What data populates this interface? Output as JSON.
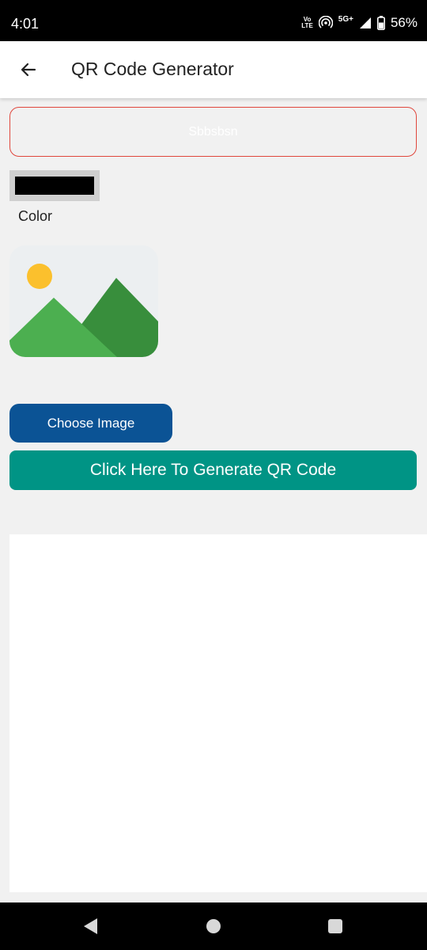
{
  "status_bar": {
    "time": "4:01",
    "volte_top": "Vo",
    "volte_bottom": "LTE",
    "network": "5G+",
    "battery": "56%",
    "icons": [
      "volte-icon",
      "hotspot-icon",
      "signal-icon",
      "battery-icon"
    ]
  },
  "app_bar": {
    "title": "QR Code Generator",
    "back_icon": "arrow-back-icon"
  },
  "input": {
    "value": "Sbbsbsn"
  },
  "color_picker": {
    "label": "Color",
    "selected_color": "#000000"
  },
  "image_preview": {
    "icon": "image-placeholder-icon"
  },
  "buttons": {
    "choose_image": "Choose Image",
    "generate": "Click Here To Generate QR Code"
  },
  "colors": {
    "choose_button": "#0b5395",
    "generate_button": "#009485",
    "input_border": "#e0463c"
  },
  "nav_bar": {
    "icons": [
      "nav-back-icon",
      "nav-home-icon",
      "nav-recents-icon"
    ]
  }
}
